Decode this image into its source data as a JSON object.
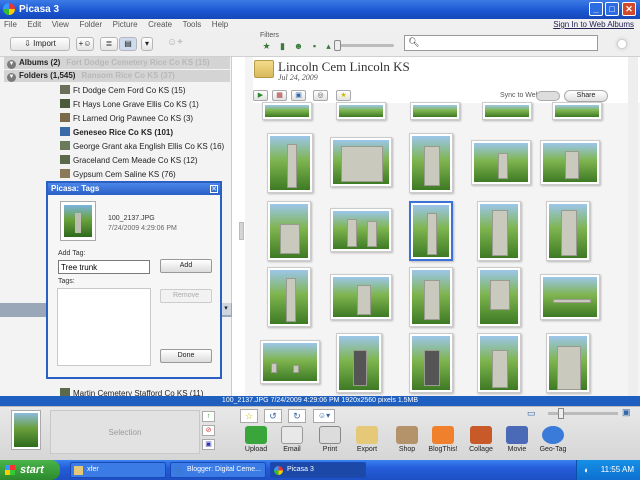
{
  "window": {
    "title": "Picasa 3",
    "min": "_",
    "max": "□",
    "close": "✕"
  },
  "menu": {
    "items": [
      "File",
      "Edit",
      "View",
      "Folder",
      "Picture",
      "Create",
      "Tools",
      "Help"
    ],
    "signin": "Sign In to Web Albums"
  },
  "toolbar": {
    "import_label": "Import",
    "filters_label": "Filters",
    "search_placeholder": ""
  },
  "left": {
    "albums_label": "Albums (2)",
    "albums_ghost": "Fort Dodge Cemetery Rice Co KS (15)",
    "folders_label": "Folders (1,545)",
    "folders_ghost": "Ransom Rice Co KS (37)",
    "folders": [
      {
        "name": "Ft Dodge Cem Ford Co KS (15)",
        "color": "#6b6f5a"
      },
      {
        "name": "Ft Hays Lone Grave Ellis Co KS (1)",
        "color": "#4a5a3a"
      },
      {
        "name": "Ft Larned Orig Pawnee Co KS (3)",
        "color": "#7a6a4a"
      },
      {
        "name": "Geneseo Rice Co KS (101)",
        "color": "#3b6aa8"
      },
      {
        "name": "George Grant aka English Ellis Co KS (16)",
        "color": "#6a7a5a"
      },
      {
        "name": "Graceland Cem Meade Co KS (12)",
        "color": "#5a6a4a"
      },
      {
        "name": "Gypsum Cem Saline KS (76)",
        "color": "#8a7a5a"
      }
    ],
    "bottom_folders": [
      {
        "name": "Martin Cemetery Stafford Co KS (11)",
        "color": "#5a6a4a"
      }
    ]
  },
  "tags_dialog": {
    "title": "Picasa: Tags",
    "close": "✕",
    "filename": "100_2137.JPG",
    "datetime": "7/24/2009 4:29:06 PM",
    "add_tag_label": "Add Tag:",
    "tag_input_value": "Tree trunk",
    "add_button": "Add",
    "tags_label": "Tags:",
    "remove_button": "Remove",
    "done_button": "Done"
  },
  "folder_view": {
    "title": "Lincoln Cem Lincoln KS",
    "date": "Jul 24, 2009",
    "sync_label": "Sync to Web:",
    "share_label": "Share"
  },
  "status": {
    "text": "100_2137.JPG    7/24/2009 4:29:06 PM    1920x2560 pixels    1.5MB"
  },
  "tray": {
    "selection_label": "Selection",
    "actions": [
      {
        "label": "Upload",
        "color": "#3aa53a"
      },
      {
        "label": "Email",
        "color": "#e8e8e8"
      },
      {
        "label": "Print",
        "color": "#dcdcdc"
      },
      {
        "label": "Export",
        "color": "#e6c879"
      },
      {
        "label": "Shop",
        "color": "#b5936a"
      },
      {
        "label": "BlogThis!",
        "color": "#f0802c"
      },
      {
        "label": "Collage",
        "color": "#c85a2a"
      },
      {
        "label": "Movie",
        "color": "#4a6ab8"
      },
      {
        "label": "Geo-Tag",
        "color": "#3a7ad8"
      }
    ]
  },
  "taskbar": {
    "start": "start",
    "tasks": [
      "xfer",
      "Blogger: Digital Ceme...",
      "Picasa 3"
    ],
    "clock": "11:55 AM"
  }
}
